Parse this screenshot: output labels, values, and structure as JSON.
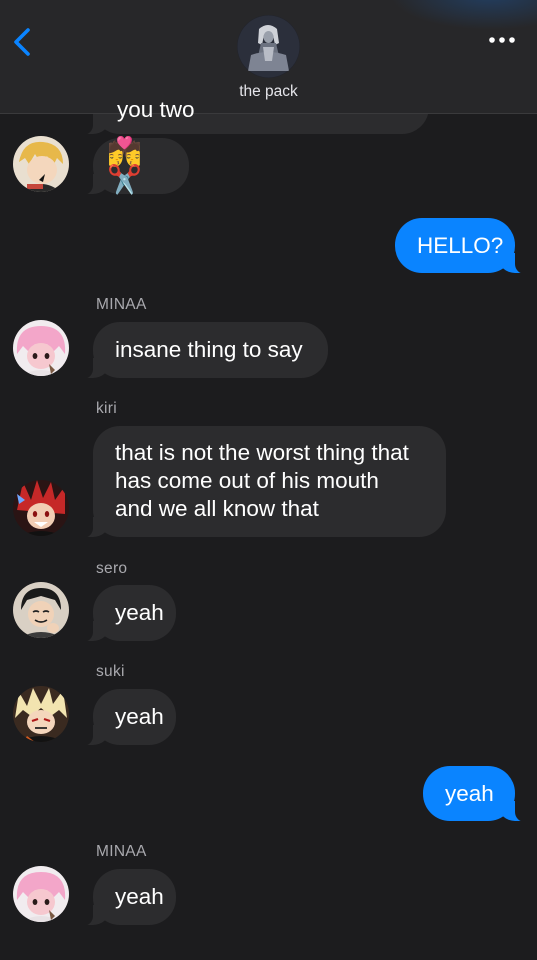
{
  "header": {
    "group_name": "the pack",
    "back_icon": "chevron-left-icon",
    "more_icon": "ellipsis-icon"
  },
  "messages": {
    "clipped_top": "you two",
    "m1": {
      "text": "💏✂️"
    },
    "m2": {
      "text": "HELLO?"
    },
    "m3": {
      "sender": "MINAA",
      "text": "insane thing to say"
    },
    "m4": {
      "sender": "kiri",
      "text": "that is not the worst thing that\nhas come out of his mouth\nand we all know that"
    },
    "m5": {
      "sender": "sero",
      "text": "yeah"
    },
    "m6": {
      "sender": "suki",
      "text": "yeah"
    },
    "m7": {
      "text": "yeah"
    },
    "m8": {
      "sender": "MINAA",
      "text": "yeah"
    }
  },
  "colors": {
    "background": "#1c1c1e",
    "incoming_bubble": "#2c2c2e",
    "outgoing_bubble": "#0a84ff",
    "accent": "#0a84ff"
  }
}
